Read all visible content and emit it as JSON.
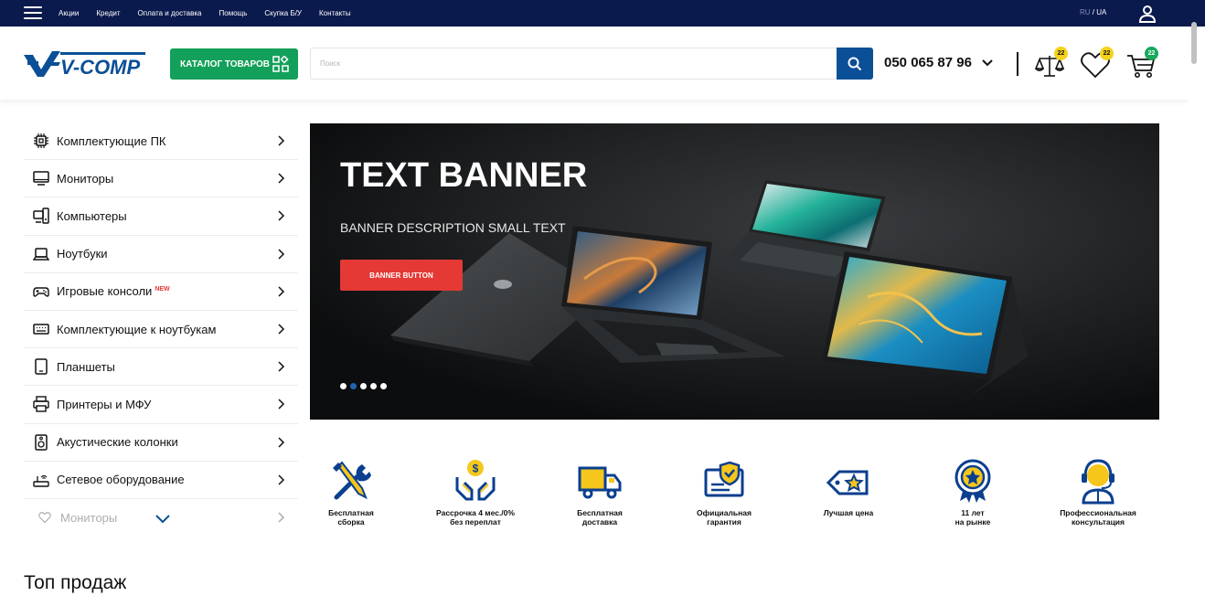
{
  "topbar": {
    "links": [
      "Акции",
      "Кредит",
      "Оплата и доставка",
      "Помощь",
      "Скупка Б/У",
      "Контакты"
    ],
    "lang_ru": "RU",
    "lang_sep": " / ",
    "lang_ua": "UA"
  },
  "header": {
    "logo_text": "V-COMP",
    "catalog_label": "КАТАЛОГ ТОВАРОВ",
    "search_placeholder": "Поиск",
    "phone": "050 065 87 96",
    "compare_count": "22",
    "favorites_count": "22",
    "cart_count": "22"
  },
  "sidebar": {
    "items": [
      {
        "label": "Комплектующие ПК",
        "icon": "cpu-icon"
      },
      {
        "label": "Мониторы",
        "icon": "monitor-icon"
      },
      {
        "label": "Компьютеры",
        "icon": "desktop-computer-icon"
      },
      {
        "label": "Ноутбуки",
        "icon": "laptop-icon"
      },
      {
        "label": "Игровые консоли",
        "icon": "gamepad-icon",
        "badge": "NEW"
      },
      {
        "label": "Комплектующие к ноутбукам",
        "icon": "keyboard-icon"
      },
      {
        "label": "Планшеты",
        "icon": "tablet-icon"
      },
      {
        "label": "Принтеры и МФУ",
        "icon": "printer-icon"
      },
      {
        "label": "Акустические колонки",
        "icon": "speaker-icon"
      },
      {
        "label": "Сетевое оборудование",
        "icon": "router-icon"
      },
      {
        "label": "Мониторы",
        "icon": "heart-icon"
      }
    ]
  },
  "banner": {
    "title": "TEXT BANNER",
    "description": "BANNER DESCRIPTION SMALL TEXT",
    "button_label": "BANNER BUTTON",
    "slides": 5,
    "active_slide": 2
  },
  "features": [
    {
      "label": "Бесплатная\nсборка",
      "icon": "tools-icon"
    },
    {
      "label": "Рассрочка 4 мес./0%\nбез переплат",
      "icon": "installment-icon"
    },
    {
      "label": "Бесплатная\nдоставка",
      "icon": "delivery-truck-icon"
    },
    {
      "label": "Официальная\nгарантия",
      "icon": "warranty-shield-icon"
    },
    {
      "label": "Лучшая цена",
      "icon": "price-tag-icon"
    },
    {
      "label": "11 лет\nна рынке",
      "icon": "award-badge-icon"
    },
    {
      "label": "Профессиональная\nконсультация",
      "icon": "consultant-icon"
    }
  ],
  "sections": {
    "top_sales_title": "Топ продаж"
  },
  "colors": {
    "topbar_bg": "#0b1a4d",
    "catalog_green": "#13a05a",
    "search_blue": "#0b4f96",
    "banner_button_red": "#e53935",
    "feature_blue": "#0b3f8f",
    "feature_yellow": "#f5c61b"
  }
}
